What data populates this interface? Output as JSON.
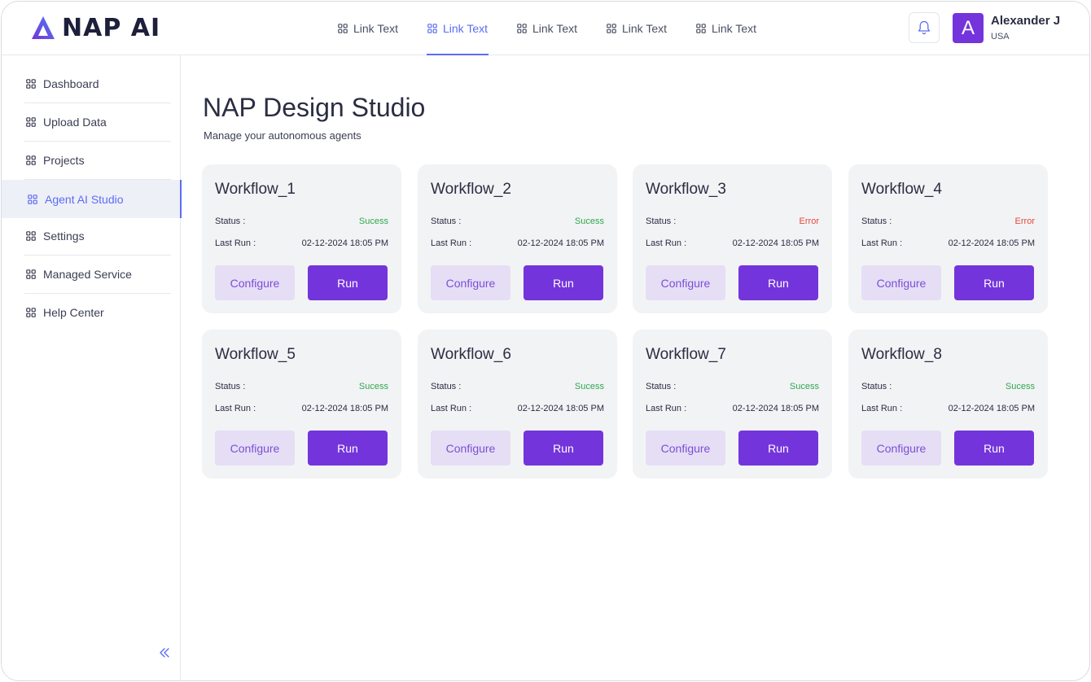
{
  "brand": {
    "name": "NAP AI",
    "accent": "#7434db",
    "active_link_color": "#5b6df2"
  },
  "topnav": {
    "items": [
      {
        "label": "Link Text",
        "active": false
      },
      {
        "label": "Link Text",
        "active": true
      },
      {
        "label": "Link Text",
        "active": false
      },
      {
        "label": "Link Text",
        "active": false
      },
      {
        "label": "Link Text",
        "active": false
      }
    ]
  },
  "user": {
    "initial": "A",
    "name": "Alexander J",
    "country": "USA"
  },
  "header_icons": {
    "notifications": "bell-icon",
    "nav_icon": "grid-icon"
  },
  "sidebar": {
    "items": [
      {
        "label": "Dashboard",
        "active": false
      },
      {
        "label": "Upload Data",
        "active": false
      },
      {
        "label": "Projects",
        "active": false
      },
      {
        "label": "Agent AI Studio",
        "active": true
      },
      {
        "label": "Settings",
        "active": false
      },
      {
        "label": "Managed Service",
        "active": false
      },
      {
        "label": "Help Center",
        "active": false
      }
    ],
    "collapse_icon": "double-chevron-left-icon"
  },
  "main": {
    "title": "NAP Design Studio",
    "subtitle": "Manage your autonomous agents",
    "status_label": "Status :",
    "last_run_label": "Last Run :",
    "configure_label": "Configure",
    "run_label": "Run",
    "workflows": [
      {
        "name": "Workflow_1",
        "status": "Sucess",
        "last_run": "02-12-2024 18:05 PM"
      },
      {
        "name": "Workflow_2",
        "status": "Sucess",
        "last_run": "02-12-2024 18:05 PM"
      },
      {
        "name": "Workflow_3",
        "status": "Error",
        "last_run": "02-12-2024 18:05 PM"
      },
      {
        "name": "Workflow_4",
        "status": "Error",
        "last_run": "02-12-2024 18:05 PM"
      },
      {
        "name": "Workflow_5",
        "status": "Sucess",
        "last_run": "02-12-2024 18:05 PM"
      },
      {
        "name": "Workflow_6",
        "status": "Sucess",
        "last_run": "02-12-2024 18:05 PM"
      },
      {
        "name": "Workflow_7",
        "status": "Sucess",
        "last_run": "02-12-2024 18:05 PM"
      },
      {
        "name": "Workflow_8",
        "status": "Sucess",
        "last_run": "02-12-2024 18:05 PM"
      }
    ],
    "status_colors": {
      "Sucess": "#2fa84f",
      "Error": "#e5483c"
    }
  }
}
